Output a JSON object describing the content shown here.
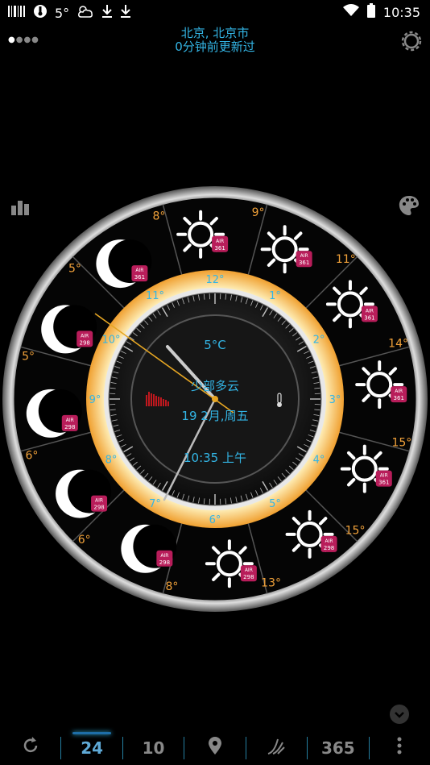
{
  "status_bar": {
    "temperature": "5°",
    "time": "10:35"
  },
  "header": {
    "location": "北京, 北京市",
    "updated": "0分钟前更新过"
  },
  "clock": {
    "current_temp": "5°C",
    "condition": "少部多云",
    "date": "19 2月,周五",
    "time": "10:35 上午",
    "hour_labels": [
      "12",
      "1",
      "2",
      "3",
      "4",
      "5",
      "6",
      "7",
      "8",
      "9",
      "10",
      "11"
    ],
    "outer_temps": [
      "9°",
      "11°",
      "14°",
      "15°",
      "15°",
      "13°",
      "8°",
      "6°",
      "6°",
      "5°",
      "5°",
      "8°"
    ],
    "aqi_badges": [
      {
        "label": "AIR",
        "value": "361"
      },
      {
        "label": "AIR",
        "value": "361"
      },
      {
        "label": "AIR",
        "value": "361"
      },
      {
        "label": "AIR",
        "value": "361"
      },
      {
        "label": "AIR",
        "value": "298"
      },
      {
        "label": "AIR",
        "value": "298"
      },
      {
        "label": "AIR",
        "value": "298"
      },
      {
        "label": "AIR",
        "value": "298"
      },
      {
        "label": "AIR",
        "value": "298"
      },
      {
        "label": "AIR",
        "value": "298"
      },
      {
        "label": "AIR",
        "value": "361"
      },
      {
        "label": "AIR",
        "value": "361"
      }
    ]
  },
  "bottom_bar": {
    "tab_24": "24",
    "tab_10": "10",
    "tab_365": "365"
  },
  "colors": {
    "accent": "#33b5e5",
    "temp_orange": "#f2a23a",
    "aqi_badge": "#b81d5a"
  },
  "icons": [
    "barcode-icon",
    "thermometer-icon",
    "cloud-sun-icon",
    "download-icon",
    "wifi-icon",
    "battery-icon",
    "gear-icon",
    "bar-chart-icon",
    "palette-icon",
    "refresh-icon",
    "location-pin-icon",
    "trend-icon",
    "more-vert-icon",
    "chevron-down-icon"
  ]
}
